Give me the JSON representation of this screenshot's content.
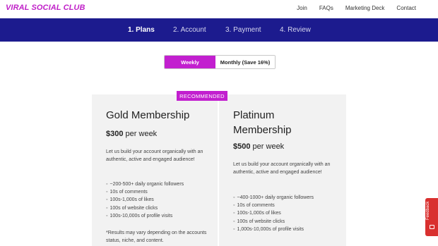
{
  "brand": {
    "logo_text": "VIRAL SOCIAL CLUB"
  },
  "topnav": {
    "items": [
      "Join",
      "FAQs",
      "Marketing Deck",
      "Contact"
    ]
  },
  "steps": {
    "items": [
      "1. Plans",
      "2. Account",
      "3. Payment",
      "4. Review"
    ],
    "active": 0
  },
  "billing_toggle": {
    "options": [
      "Weekly",
      "Monthly (Save 16%)"
    ],
    "selected": "Weekly"
  },
  "plans": [
    {
      "title": "Gold Membership",
      "badge": "",
      "price": "$300",
      "period": "per week",
      "description": "Let us build your account organically with an authentic, active and engaged audience!",
      "features": [
        "~200-500+ daily organic followers",
        "10s of comments",
        "100s-1,000s of likes",
        "100s of website clicks",
        "100s-10,000s of profile visits"
      ],
      "note": "*Results may vary depending on the accounts status, niche, and content."
    },
    {
      "title": "Platinum Membership",
      "badge": "RECOMMENDED",
      "price": "$500",
      "period": "per week",
      "description": "Let us build your account organically with an authentic, active and engaged audience!",
      "features": [
        "~400-1000+ daily organic followers",
        "10s of comments",
        "100s-1,000s of likes",
        "100s of website clicks",
        "1,000s-10,000s of profile visits"
      ],
      "note": ""
    }
  ],
  "feedback_tab": {
    "label": "Feedback",
    "icon": "chat-icon"
  },
  "colors": {
    "accent": "#c21fcf",
    "stepbar": "#1c1b8e",
    "feedback": "#d9302f"
  }
}
